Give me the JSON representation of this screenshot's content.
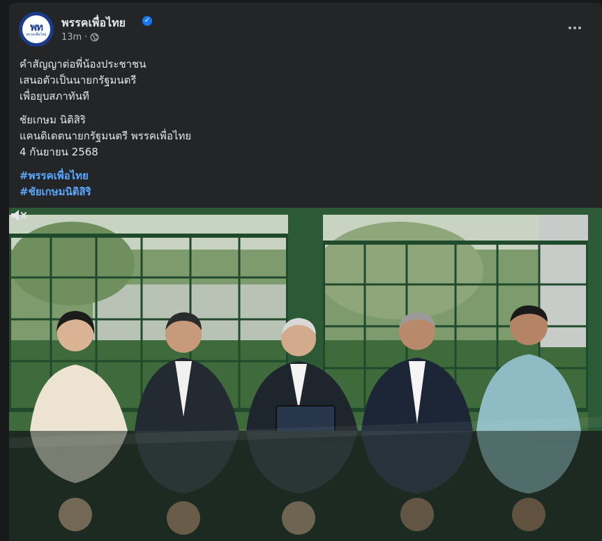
{
  "post": {
    "page_name": "พรรคเพื่อไทย",
    "avatar_mark": "พท",
    "avatar_sub": "พรรคเพื่อไทย",
    "time": "13m",
    "separator": "·",
    "caption_lines": [
      "คำสัญญาต่อพี่น้องประชาชน",
      "เสนอตัวเป็นนายกรัฐมนตรี",
      "เพื่อยุบสภาทันที"
    ],
    "signature_lines": [
      "ชัยเกษม นิติสิริ",
      "แคนดิเดตนายกรัฐมนตรี พรรคเพื่อไทย",
      "4 กันยายน 2568"
    ],
    "hashtags": [
      "#พรรคเพื่อไทย",
      "#ชัยเกษมนิติสิริ"
    ]
  },
  "icons": {
    "verified": "verified-badge-icon",
    "audience": "globe-icon",
    "menu": "more-options-icon",
    "sound": "muted-speaker-icon"
  },
  "colors": {
    "card": "#242526",
    "background": "#18191a",
    "hashtag": "#5aa7ff",
    "verified": "#1877f2"
  }
}
